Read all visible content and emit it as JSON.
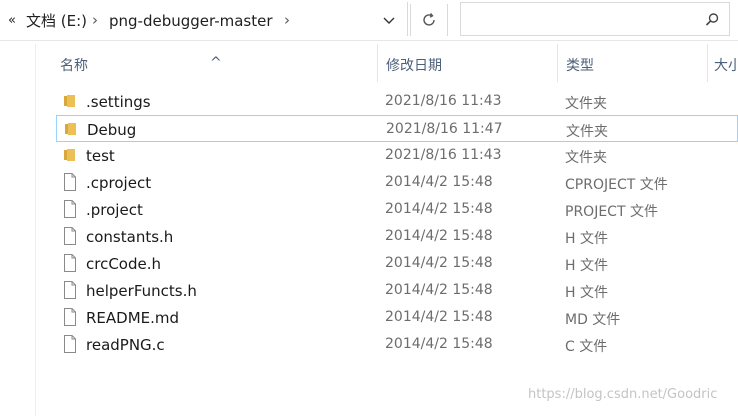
{
  "address": {
    "overflow": "«",
    "breadcrumb": [
      "文档 (E:)",
      "png-debugger-master"
    ],
    "separator": "›"
  },
  "search": {
    "placeholder": ""
  },
  "columns": {
    "name": "名称",
    "date": "修改日期",
    "type": "类型",
    "size": "大小"
  },
  "sort_indicator": "^",
  "files": [
    {
      "name": ".settings",
      "date": "2021/8/16 11:43",
      "type": "文件夹",
      "icon": "folder-icon"
    },
    {
      "name": "Debug",
      "date": "2021/8/16 11:47",
      "type": "文件夹",
      "icon": "folder-icon"
    },
    {
      "name": "test",
      "date": "2021/8/16 11:43",
      "type": "文件夹",
      "icon": "folder-icon"
    },
    {
      "name": ".cproject",
      "date": "2014/4/2 15:48",
      "type": "CPROJECT 文件",
      "icon": "file-icon"
    },
    {
      "name": ".project",
      "date": "2014/4/2 15:48",
      "type": "PROJECT 文件",
      "icon": "file-icon"
    },
    {
      "name": "constants.h",
      "date": "2014/4/2 15:48",
      "type": "H 文件",
      "icon": "file-icon"
    },
    {
      "name": "crcCode.h",
      "date": "2014/4/2 15:48",
      "type": "H 文件",
      "icon": "file-icon"
    },
    {
      "name": "helperFuncts.h",
      "date": "2014/4/2 15:48",
      "type": "H 文件",
      "icon": "file-icon"
    },
    {
      "name": "README.md",
      "date": "2014/4/2 15:48",
      "type": "MD 文件",
      "icon": "file-icon"
    },
    {
      "name": "readPNG.c",
      "date": "2014/4/2 15:48",
      "type": "C 文件",
      "icon": "file-icon"
    }
  ],
  "watermark": "https://blog.csdn.net/Goodric",
  "colors": {
    "folder": "#e8b84a",
    "focus_border": "#99d1ff",
    "header_text": "#4c607a"
  }
}
